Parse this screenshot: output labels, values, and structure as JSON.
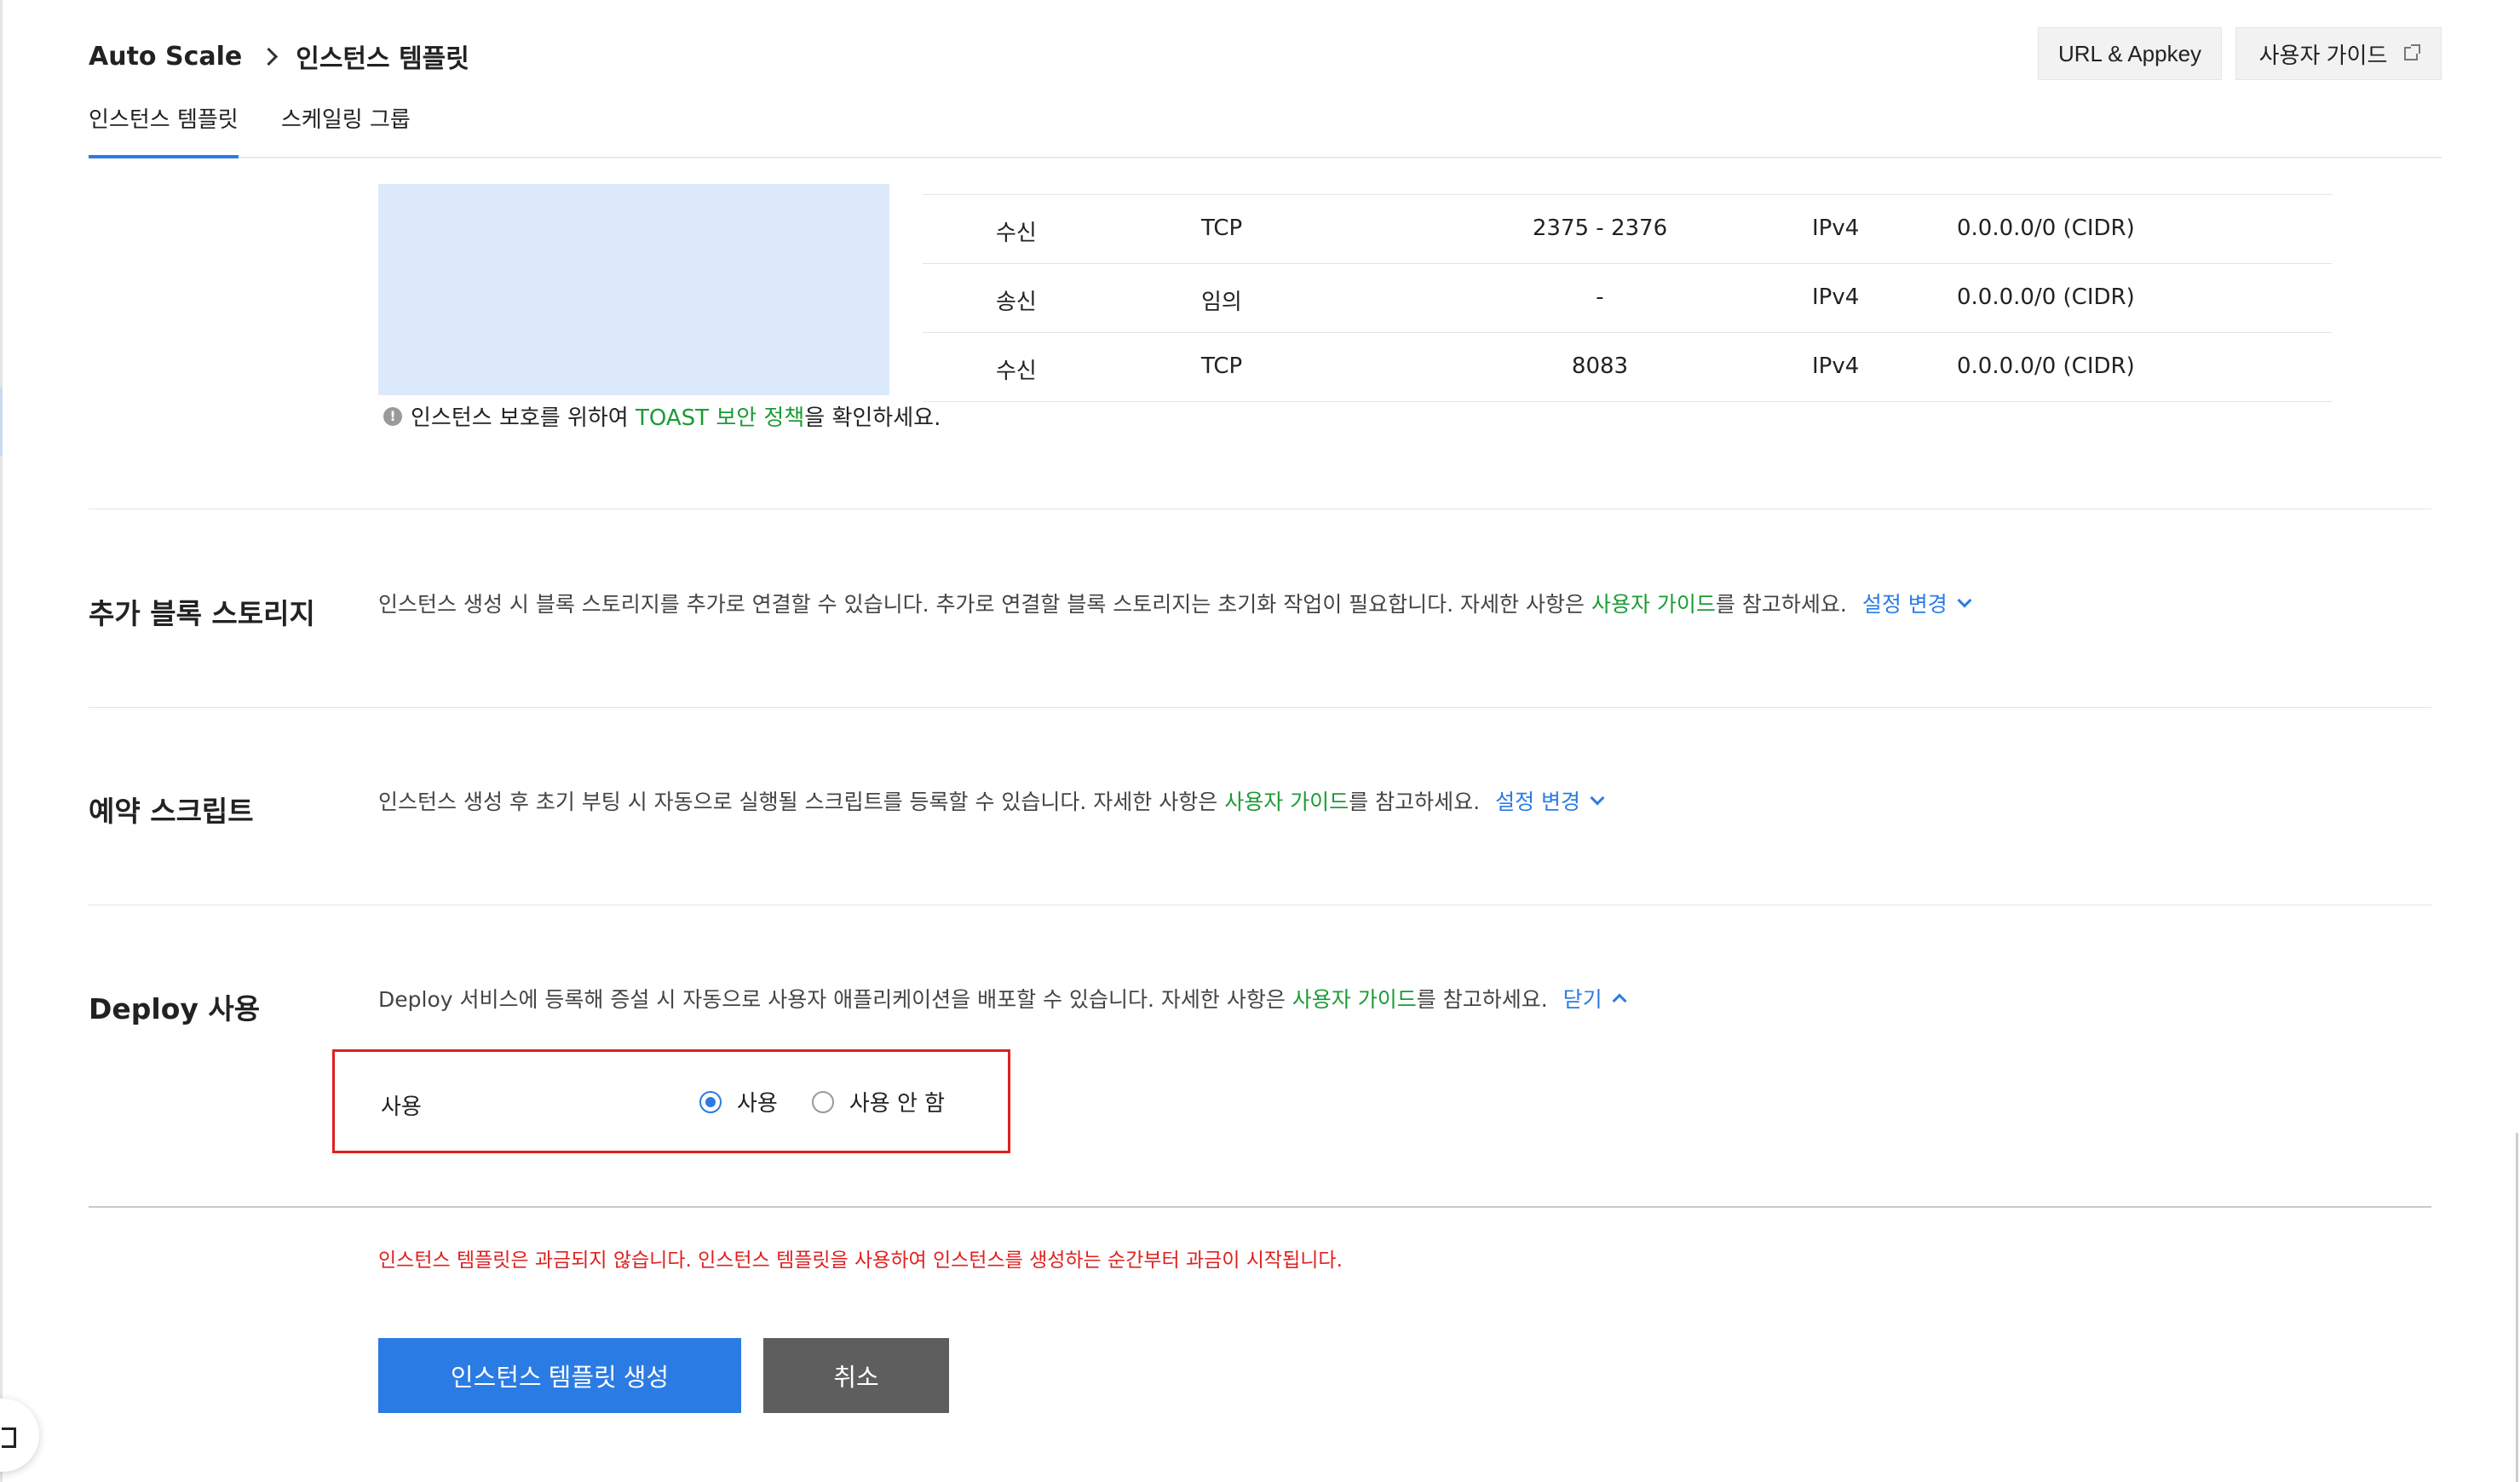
{
  "breadcrumb": {
    "root": "Auto Scale",
    "current": "인스턴스 템플릿"
  },
  "header_buttons": {
    "url_appkey": "URL & Appkey",
    "user_guide": "사용자 가이드"
  },
  "tabs": [
    {
      "label": "인스턴스 템플릿",
      "active": true
    },
    {
      "label": "스케일링 그룹",
      "active": false
    }
  ],
  "security_rules": [
    {
      "direction": "수신",
      "protocol": "TCP",
      "port": "2375 - 2376",
      "ether": "IPv4",
      "remote": "0.0.0.0/0 (CIDR)"
    },
    {
      "direction": "송신",
      "protocol": "임의",
      "port": "-",
      "ether": "IPv4",
      "remote": "0.0.0.0/0 (CIDR)"
    },
    {
      "direction": "수신",
      "protocol": "TCP",
      "port": "8083",
      "ether": "IPv4",
      "remote": "0.0.0.0/0 (CIDR)"
    }
  ],
  "security_note": {
    "icon": "info-icon",
    "prefix": "인스턴스 보호를 위하여 ",
    "link": "TOAST 보안 정책",
    "suffix": "을 확인하세요."
  },
  "block_storage": {
    "title": "추가 블록 스토리지",
    "desc": "인스턴스 생성 시 블록 스토리지를 추가로 연결할 수 있습니다. 추가로 연결할 블록 스토리지는 초기화 작업이 필요합니다. 자세한 사항은 ",
    "guide_link": "사용자 가이드",
    "desc_suffix": "를 참고하세요.",
    "toggle": "설정 변경"
  },
  "reserved_script": {
    "title": "예약 스크립트",
    "desc": "인스턴스 생성 후 초기 부팅 시 자동으로 실행될 스크립트를 등록할 수 있습니다. 자세한 사항은 ",
    "guide_link": "사용자 가이드",
    "desc_suffix": "를 참고하세요.",
    "toggle": "설정 변경"
  },
  "deploy": {
    "title": "Deploy 사용",
    "desc": "Deploy 서비스에 등록해 증설 시 자동으로 사용자 애플리케이션을 배포할 수 있습니다. 자세한 사항은 ",
    "guide_link": "사용자 가이드",
    "desc_suffix": "를 참고하세요.",
    "toggle": "닫기",
    "field_label": "사용",
    "options": [
      {
        "label": "사용",
        "selected": true
      },
      {
        "label": "사용 안 함",
        "selected": false
      }
    ]
  },
  "billing_warning": "인스턴스 템플릿은 과금되지 않습니다. 인스턴스 템플릿을 사용하여 인스턴스를 생성하는 순간부터 과금이 시작됩니다.",
  "actions": {
    "create": "인스턴스 템플릿 생성",
    "cancel": "취소"
  },
  "colors": {
    "accent": "#2b7be4",
    "link_green": "#1b9b35",
    "warning_red": "#e02020",
    "highlight_box": "#e02020"
  }
}
